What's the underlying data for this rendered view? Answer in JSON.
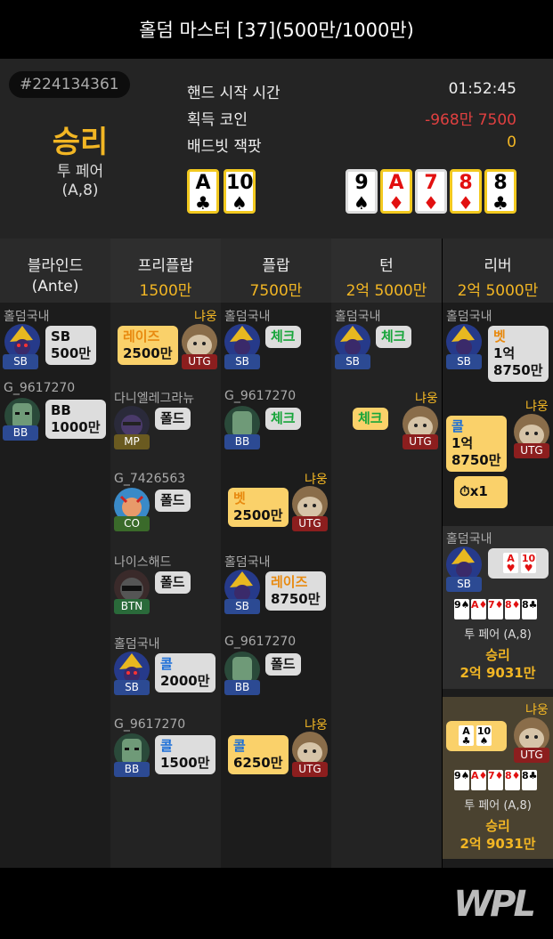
{
  "title": "홀덤 마스터 [37](500만/1000만)",
  "hand_id": "#224134361",
  "result": {
    "label": "승리",
    "hand": "투 페어",
    "cards": "(A,8)"
  },
  "info": {
    "start_label": "핸드 시작 시간",
    "start_value": "01:52:45",
    "coin_label": "획득 코인",
    "coin_value": "-968만 7500",
    "jackpot_label": "배드빗 잭팟",
    "jackpot_value": "0"
  },
  "hole_cards": [
    {
      "rank": "A",
      "suit": "♣"
    },
    {
      "rank": "10",
      "suit": "♠"
    }
  ],
  "board": [
    {
      "rank": "9",
      "suit": "♠"
    },
    {
      "rank": "A",
      "suit": "♦"
    },
    {
      "rank": "7",
      "suit": "♦"
    },
    {
      "rank": "8",
      "suit": "♦"
    },
    {
      "rank": "8",
      "suit": "♣"
    }
  ],
  "columns": [
    {
      "title": "블라인드",
      "amount": "(Ante)"
    },
    {
      "title": "프리플랍",
      "amount": "1500만"
    },
    {
      "title": "플랍",
      "amount": "7500만"
    },
    {
      "title": "턴",
      "amount": "2억 5000만"
    },
    {
      "title": "리버",
      "amount": "2억 5000만"
    }
  ],
  "blinds": [
    {
      "name": "홀덤국내",
      "pos": "SB",
      "action": "SB",
      "amount": "500만"
    },
    {
      "name": "G_9617270",
      "pos": "BB",
      "action": "BB",
      "amount": "1000만"
    }
  ],
  "preflop": [
    {
      "name": "냐웅",
      "pos": "UTG",
      "action": "레이즈",
      "amount": "2500만"
    },
    {
      "name": "다니엘레그라뉴",
      "pos": "MP",
      "action": "폴드",
      "amount": ""
    },
    {
      "name": "G_7426563",
      "pos": "CO",
      "action": "폴드",
      "amount": ""
    },
    {
      "name": "나이스해드",
      "pos": "BTN",
      "action": "폴드",
      "amount": ""
    },
    {
      "name": "홀덤국내",
      "pos": "SB",
      "action": "콜",
      "amount": "2000만"
    },
    {
      "name": "G_9617270",
      "pos": "BB",
      "action": "콜",
      "amount": "1500만"
    }
  ],
  "flop": [
    {
      "name": "홀덤국내",
      "pos": "SB",
      "action": "체크",
      "amount": ""
    },
    {
      "name": "G_9617270",
      "pos": "BB",
      "action": "체크",
      "amount": ""
    },
    {
      "name": "냐웅",
      "pos": "UTG",
      "action": "벳",
      "amount": "2500만"
    },
    {
      "name": "홀덤국내",
      "pos": "SB",
      "action": "레이즈",
      "amount": "8750만"
    },
    {
      "name": "G_9617270",
      "pos": "BB",
      "action": "폴드",
      "amount": ""
    },
    {
      "name": "냐웅",
      "pos": "UTG",
      "action": "콜",
      "amount": "6250만"
    }
  ],
  "turn": [
    {
      "name": "홀덤국내",
      "pos": "SB",
      "action": "체크",
      "amount": ""
    },
    {
      "name": "냐웅",
      "pos": "UTG",
      "action": "체크",
      "amount": ""
    }
  ],
  "river": [
    {
      "name": "홀덤국내",
      "pos": "SB",
      "action": "벳",
      "amount": "1억\n8750만"
    },
    {
      "name": "냐웅",
      "pos": "UTG",
      "action": "콜",
      "amount": "1억\n8750만"
    }
  ],
  "timebank": "x1",
  "showdown": [
    {
      "name": "홀덤국내",
      "pos": "SB",
      "cards": [
        {
          "rank": "A",
          "suit": "♥"
        },
        {
          "rank": "10",
          "suit": "♥"
        }
      ],
      "board": [
        "9♠",
        "A♦",
        "7♦",
        "8♦",
        "8♣"
      ],
      "hand": "투 페어 (A,8)",
      "result": "승리",
      "amount": "2억 9031만"
    },
    {
      "name": "냐웅",
      "pos": "UTG",
      "cards": [
        {
          "rank": "A",
          "suit": "♣"
        },
        {
          "rank": "10",
          "suit": "♠"
        }
      ],
      "board": [
        "9♠",
        "A♦",
        "7♦",
        "8♦",
        "8♣"
      ],
      "hand": "투 페어 (A,8)",
      "result": "승리",
      "amount": "2억 9031만"
    }
  ],
  "logo": "WPL"
}
